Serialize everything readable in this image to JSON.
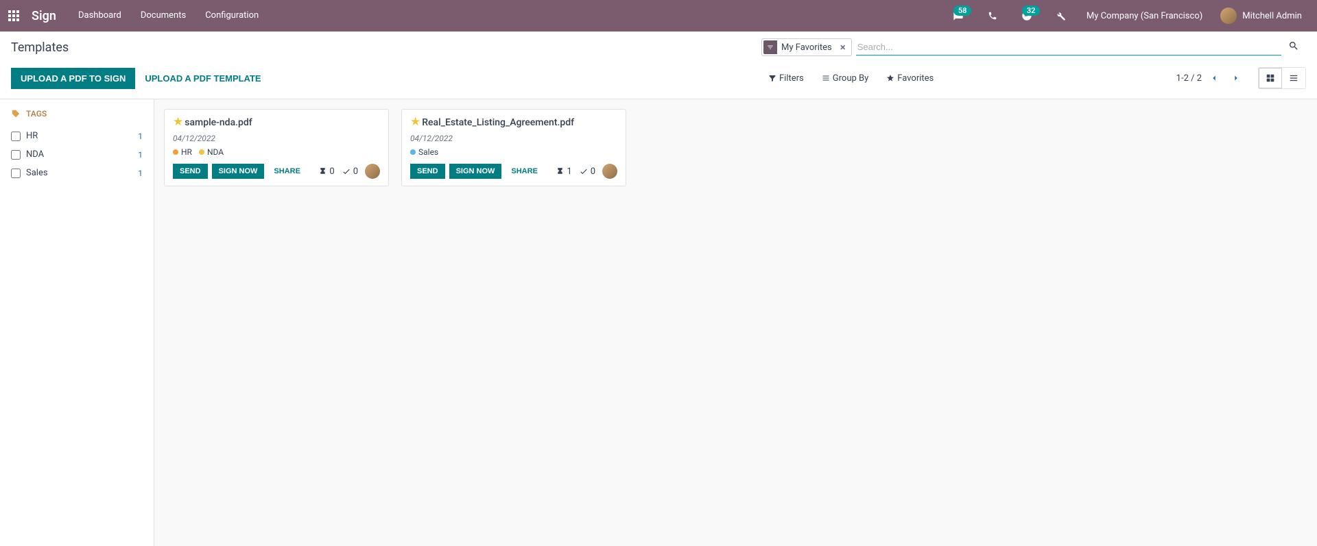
{
  "navbar": {
    "brand": "Sign",
    "links": [
      "Dashboard",
      "Documents",
      "Configuration"
    ],
    "messages_badge": "58",
    "activities_badge": "32",
    "company": "My Company (San Francisco)",
    "user": "Mitchell Admin"
  },
  "header": {
    "title": "Templates",
    "filter_pill": "My Favorites",
    "search_placeholder": "Search..."
  },
  "toolbar": {
    "upload_sign": "Upload a PDF to Sign",
    "upload_template": "Upload a PDF Template",
    "filters": "Filters",
    "group_by": "Group By",
    "favorites": "Favorites",
    "pager": "1-2 / 2"
  },
  "sidebar": {
    "header": "TAGS",
    "tags": [
      {
        "label": "HR",
        "count": "1"
      },
      {
        "label": "NDA",
        "count": "1"
      },
      {
        "label": "Sales",
        "count": "1"
      }
    ]
  },
  "tag_colors": {
    "HR": "#f3a03a",
    "NDA": "#eac645",
    "Sales": "#5bb5e8"
  },
  "cards": [
    {
      "title": "sample-nda.pdf",
      "date": "04/12/2022",
      "tags": [
        "HR",
        "NDA"
      ],
      "send": "Send",
      "sign_now": "Sign Now",
      "share": "Share",
      "pending": "0",
      "done": "0"
    },
    {
      "title": "Real_Estate_Listing_Agreement.pdf",
      "date": "04/12/2022",
      "tags": [
        "Sales"
      ],
      "send": "Send",
      "sign_now": "Sign Now",
      "share": "Share",
      "pending": "1",
      "done": "0"
    }
  ]
}
